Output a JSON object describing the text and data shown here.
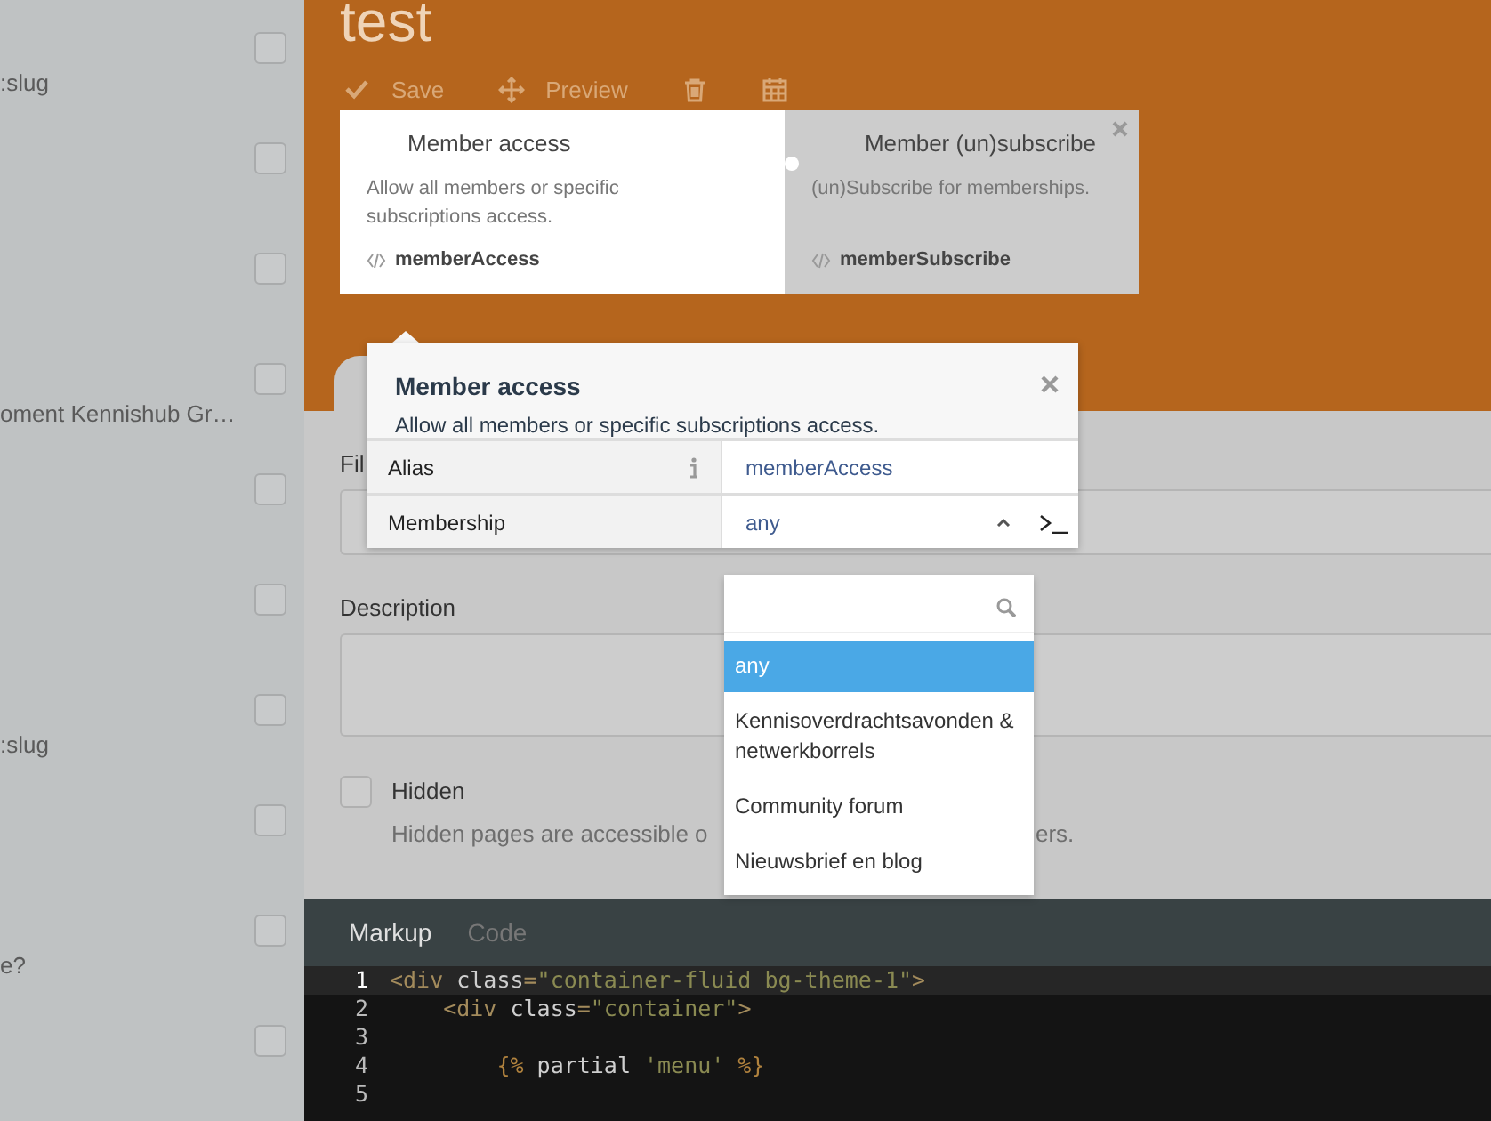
{
  "sidebar": {
    "rows": [
      {
        "text": ":slug",
        "checked": false
      },
      {
        "checked": false
      },
      {
        "checked": false
      },
      {
        "text": "oment Kennishub Gr…",
        "checked": false
      },
      {
        "checked": false
      },
      {
        "checked": false
      },
      {
        "text": ":slug",
        "checked": false
      },
      {
        "checked": false
      },
      {
        "text": "e?",
        "checked": false
      },
      {
        "checked": false
      }
    ]
  },
  "page": {
    "title": "test",
    "toolbar": [
      {
        "kind": "save",
        "label": "Save"
      },
      {
        "kind": "preview",
        "label": "Preview"
      },
      {
        "kind": "delete"
      },
      {
        "kind": "schedule"
      }
    ]
  },
  "components": [
    {
      "title": "Member access",
      "description": "Allow all members or specific subscriptions access.",
      "alias": "memberAccess",
      "selected": true,
      "removable": false
    },
    {
      "title": "Member (un)subscribe",
      "description": "(un)Subscribe for memberships.",
      "alias": "memberSubscribe",
      "selected": false,
      "removable": true
    }
  ],
  "form": {
    "fields": [
      {
        "kind": "input",
        "label": "Fil"
      },
      {
        "kind": "textarea",
        "label": "Description"
      }
    ],
    "hidden": {
      "label": "Hidden",
      "checked": false,
      "help_left": "Hidden pages are accessible o",
      "help_right": "ers."
    }
  },
  "popover": {
    "title": "Member access",
    "description": "Allow all members or specific subscriptions access.",
    "properties": [
      {
        "kind": "text",
        "label": "Alias",
        "value": "memberAccess",
        "info": true
      },
      {
        "kind": "dropdown",
        "label": "Membership",
        "value": "any",
        "expanded": true,
        "options": [
          {
            "label": "any",
            "selected": true
          },
          {
            "label": "Kennisoverdrachtsavonden & netwerkborrels",
            "selected": false
          },
          {
            "label": "Community forum",
            "selected": false
          },
          {
            "label": "Nieuwsbrief en blog",
            "selected": false
          }
        ]
      }
    ]
  },
  "editor": {
    "tabs": [
      {
        "label": "Markup",
        "selected": true
      },
      {
        "label": "Code",
        "selected": false
      }
    ],
    "lines": [
      {
        "number": "1",
        "active": true,
        "tokens": [
          {
            "kind": "tag",
            "text": "<div"
          },
          {
            "kind": "plain",
            "text": " class"
          },
          {
            "kind": "punct",
            "text": "="
          },
          {
            "kind": "string",
            "text": "\"container-fluid bg-theme-1\""
          },
          {
            "kind": "tag",
            "text": ">"
          }
        ]
      },
      {
        "number": "2",
        "active": false,
        "tokens": [
          {
            "kind": "tag",
            "text": "    <div"
          },
          {
            "kind": "plain",
            "text": " class"
          },
          {
            "kind": "punct",
            "text": "="
          },
          {
            "kind": "string",
            "text": "\"container\""
          },
          {
            "kind": "tag",
            "text": ">"
          }
        ]
      },
      {
        "number": "3",
        "active": false
      },
      {
        "number": "4",
        "active": false,
        "tokens": [
          {
            "kind": "twig",
            "text": "        {%"
          },
          {
            "kind": "plain",
            "text": " partial "
          },
          {
            "kind": "string",
            "text": "'menu'"
          },
          {
            "kind": "twig",
            "text": " %}"
          }
        ]
      },
      {
        "number": "5",
        "active": false
      }
    ]
  }
}
